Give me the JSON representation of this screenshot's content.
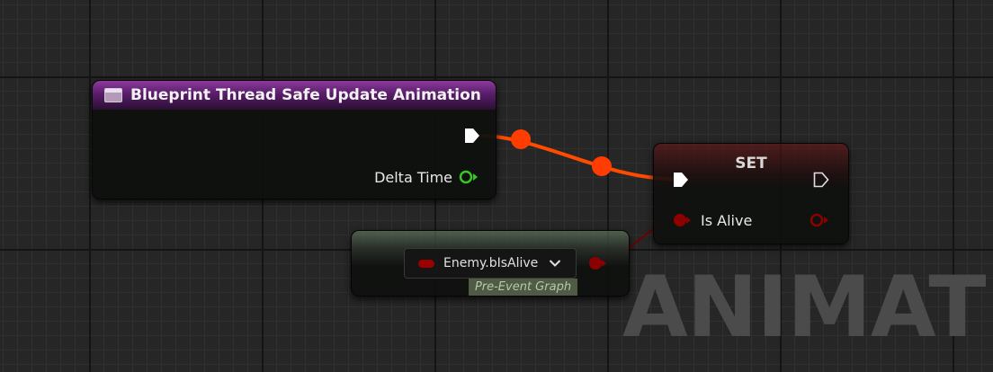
{
  "watermark": "ANIMATION",
  "event_node": {
    "title": "Blueprint Thread Safe Update Animation",
    "icon": "event-icon",
    "header_color": "#8b3a9c",
    "outputs": {
      "delta_time_label": "Delta Time"
    }
  },
  "set_node": {
    "title": "SET",
    "header_color": "#6e1414",
    "inputs": {
      "is_alive_label": "Is Alive"
    }
  },
  "getter_node": {
    "variable": "Enemy.bIsAlive",
    "subtitle": "Pre-Event Graph",
    "header_color": "#7d9a78"
  },
  "colors": {
    "exec_wire": "#ff4500",
    "bool_pin": "#8b0000",
    "float_pin": "#39c428"
  }
}
